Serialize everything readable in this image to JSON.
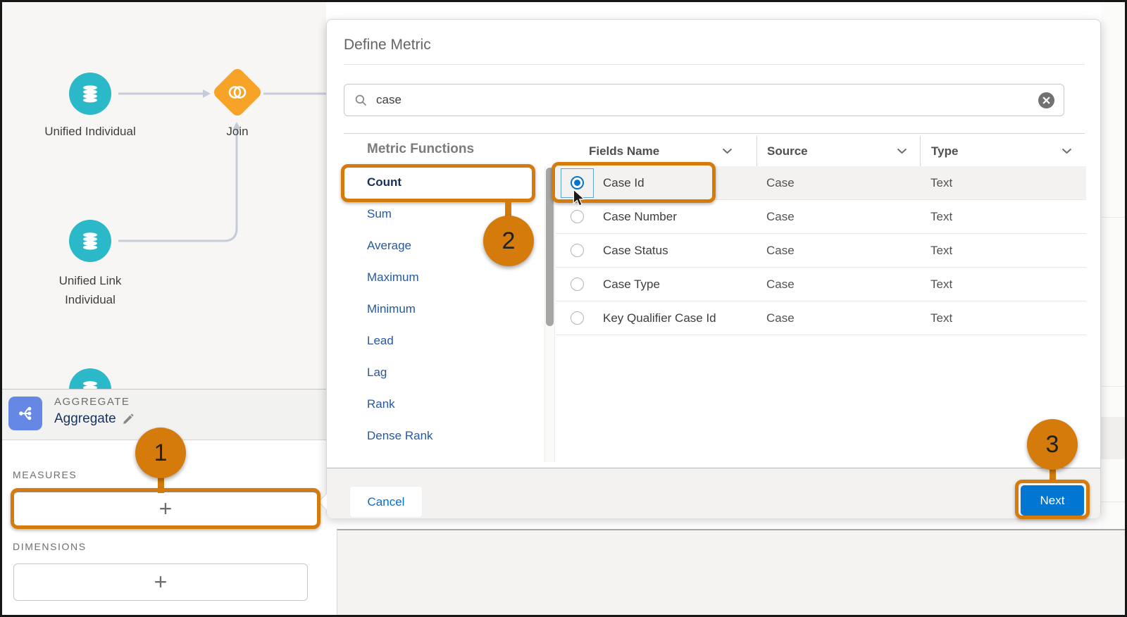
{
  "flow": {
    "node_unified_individual": "Unified Individual",
    "node_join": "Join",
    "node_unified_link_line1": "Unified Link",
    "node_unified_link_line2": "Individual"
  },
  "aggregate_panel": {
    "type_label": "AGGREGATE",
    "name": "Aggregate",
    "measures_label": "MEASURES",
    "dimensions_label": "DIMENSIONS",
    "add_measure_symbol": "+",
    "add_dimension_symbol": "+"
  },
  "dialog": {
    "title": "Define Metric",
    "search_value": "case",
    "functions_header": "Metric Functions",
    "functions": [
      {
        "label": "Count",
        "selected": true
      },
      {
        "label": "Sum",
        "selected": false
      },
      {
        "label": "Average",
        "selected": false
      },
      {
        "label": "Maximum",
        "selected": false
      },
      {
        "label": "Minimum",
        "selected": false
      },
      {
        "label": "Lead",
        "selected": false
      },
      {
        "label": "Lag",
        "selected": false
      },
      {
        "label": "Rank",
        "selected": false
      },
      {
        "label": "Dense Rank",
        "selected": false
      }
    ],
    "columns": [
      {
        "label": "Fields Name"
      },
      {
        "label": "Source"
      },
      {
        "label": "Type"
      }
    ],
    "rows": [
      {
        "field": "Case Id",
        "source": "Case",
        "type": "Text",
        "selected": true
      },
      {
        "field": "Case Number",
        "source": "Case",
        "type": "Text",
        "selected": false
      },
      {
        "field": "Case Status",
        "source": "Case",
        "type": "Text",
        "selected": false
      },
      {
        "field": "Case Type",
        "source": "Case",
        "type": "Text",
        "selected": false
      },
      {
        "field": "Key Qualifier Case Id",
        "source": "Case",
        "type": "Text",
        "selected": false
      }
    ],
    "cancel_label": "Cancel",
    "next_label": "Next"
  },
  "annotations": {
    "step1": "1",
    "step2": "2",
    "step3": "3"
  },
  "colors": {
    "annotation_orange": "#d47b0c",
    "node_teal": "#2bb8c9",
    "join_orange": "#f7a327",
    "aggregate_icon_blue": "#6488e3",
    "function_link_blue": "#2758a0",
    "selected_function_navy": "#16325c",
    "primary_button_blue": "#0176d3",
    "cancel_link_blue": "#0070d2",
    "radio_selected_blue": "#0176d3"
  }
}
